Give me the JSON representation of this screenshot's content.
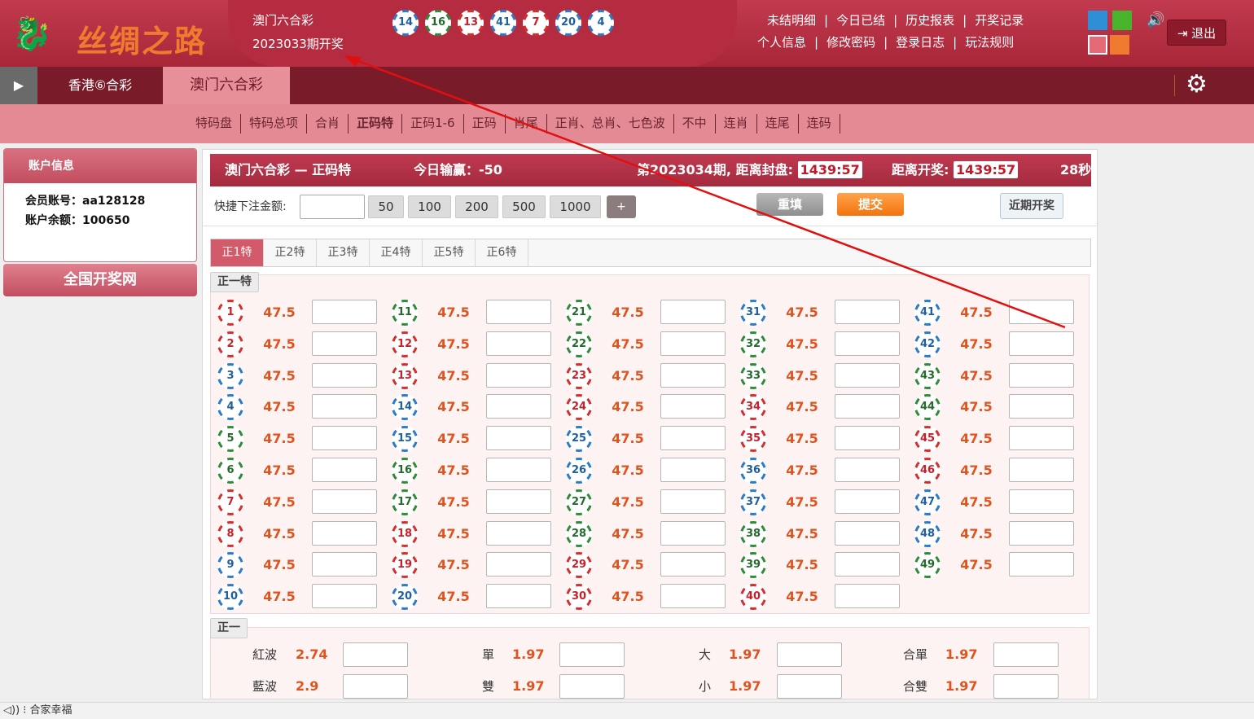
{
  "header": {
    "logo_text": "丝绸之路",
    "game_title": "澳门六合彩",
    "last_issue": "2023033期开奖",
    "last_draw_balls": [
      {
        "num": "14",
        "color": "blue"
      },
      {
        "num": "16",
        "color": "green"
      },
      {
        "num": "13",
        "color": "red"
      },
      {
        "num": "41",
        "color": "blue"
      },
      {
        "num": "7",
        "color": "red"
      },
      {
        "num": "20",
        "color": "blue"
      },
      {
        "num": "4",
        "color": "blue"
      }
    ],
    "nav_row1": [
      "未结明细",
      "今日已结",
      "历史报表",
      "开奖记录"
    ],
    "nav_row2": [
      "个人信息",
      "修改密码",
      "登录日志",
      "玩法规则"
    ],
    "nav_sep": "|",
    "logout_label": "退出",
    "theme_colors": [
      "#2f8fd6",
      "#4ab32c",
      "#e46a78",
      "#f07a30"
    ]
  },
  "lottery_tabs": [
    "香港⑥合彩",
    "澳门六合彩"
  ],
  "active_lottery": "澳门六合彩",
  "subnav": [
    "特码盘",
    "特码总项",
    "合肖",
    "正码特",
    "正码1-6",
    "正码",
    "肖尾",
    "正肖、总肖、七色波",
    "不中",
    "连肖",
    "连尾",
    "连码"
  ],
  "subnav_active": "正码特",
  "account": {
    "title": "账户信息",
    "member_label": "会员账号：",
    "member": "aa128128",
    "balance_label": "账户余额：",
    "balance": "100650"
  },
  "kaijiang_button": "全国开奖网",
  "infobar": {
    "title": "澳门六合彩 — 正码特",
    "today_label": "今日输赢：",
    "today_value": "-50",
    "issue_text": "第2023034期, 距离封盘:",
    "close_time": "1439:57",
    "draw_label": "距离开奖:",
    "draw_time": "1439:57",
    "refresh": "28秒"
  },
  "quick": {
    "label": "快捷下注金额:",
    "amounts": [
      "50",
      "100",
      "200",
      "500",
      "1000"
    ],
    "plus": "+",
    "reset": "重填",
    "submit": "提交",
    "recent": "近期开奖"
  },
  "tabs": [
    "正1特",
    "正2特",
    "正3特",
    "正4特",
    "正5特",
    "正6特"
  ],
  "active_tab": "正1特",
  "section1_title": "正一特",
  "odds": "47.5",
  "ball_colors": {
    "1": "red",
    "2": "red",
    "3": "blue",
    "4": "blue",
    "5": "green",
    "6": "green",
    "7": "red",
    "8": "red",
    "9": "blue",
    "10": "blue",
    "11": "green",
    "12": "red",
    "13": "red",
    "14": "blue",
    "15": "blue",
    "16": "green",
    "17": "green",
    "18": "red",
    "19": "red",
    "20": "blue",
    "21": "green",
    "22": "green",
    "23": "red",
    "24": "red",
    "25": "blue",
    "26": "blue",
    "27": "green",
    "28": "green",
    "29": "red",
    "30": "red",
    "31": "blue",
    "32": "green",
    "33": "green",
    "34": "red",
    "35": "red",
    "36": "blue",
    "37": "blue",
    "38": "green",
    "39": "green",
    "40": "red",
    "41": "blue",
    "42": "blue",
    "43": "green",
    "44": "green",
    "45": "red",
    "46": "red",
    "47": "blue",
    "48": "blue",
    "49": "green"
  },
  "section2_title": "正一",
  "extra_rows": [
    [
      {
        "label": "紅波",
        "odds": "2.74"
      },
      {
        "label": "單",
        "odds": "1.97"
      },
      {
        "label": "大",
        "odds": "1.97"
      },
      {
        "label": "合單",
        "odds": "1.97"
      }
    ],
    [
      {
        "label": "藍波",
        "odds": "2.9"
      },
      {
        "label": "雙",
        "odds": "1.97"
      },
      {
        "label": "小",
        "odds": "1.97"
      },
      {
        "label": "合雙",
        "odds": "1.97"
      }
    ]
  ],
  "statusbar_text": "合家幸福"
}
